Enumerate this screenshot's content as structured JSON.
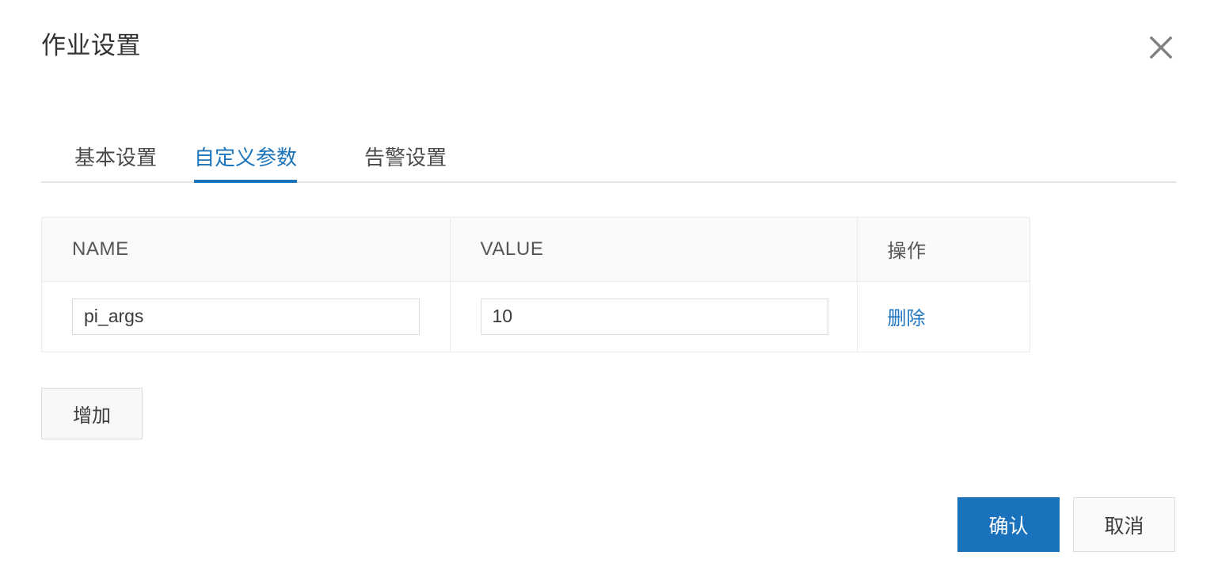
{
  "dialog": {
    "title": "作业设置",
    "close_icon": "close-icon"
  },
  "tabs": [
    {
      "label": "基本设置",
      "active": false
    },
    {
      "label": "自定义参数",
      "active": true
    },
    {
      "label": "告警设置",
      "active": false
    }
  ],
  "params_table": {
    "columns": [
      "NAME",
      "VALUE",
      "操作"
    ],
    "rows": [
      {
        "name_value": "pi_args",
        "name_placeholder": "",
        "value_value": "10",
        "value_placeholder": "",
        "action_label": "删除"
      }
    ]
  },
  "add_button": {
    "label": "增加"
  },
  "footer": {
    "confirm_label": "确认",
    "cancel_label": "取消"
  },
  "colors": {
    "accent_blue": "#1b74ba",
    "primary_button": "#1b72bc",
    "link_blue": "#2077c4",
    "border_gray": "#ebebeb",
    "header_bg": "#fafafa"
  }
}
